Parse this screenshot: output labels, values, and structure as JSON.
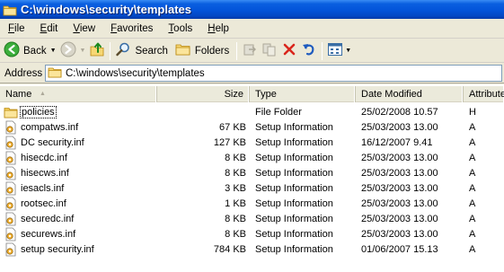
{
  "window": {
    "title": "C:\\windows\\security\\templates"
  },
  "menu": [
    "File",
    "Edit",
    "View",
    "Favorites",
    "Tools",
    "Help"
  ],
  "toolbar": {
    "back_label": "Back",
    "search_label": "Search",
    "folders_label": "Folders"
  },
  "address": {
    "label": "Address",
    "value": "C:\\windows\\security\\templates"
  },
  "columns": {
    "name": "Name",
    "size": "Size",
    "type": "Type",
    "date": "Date Modified",
    "attr": "Attributes"
  },
  "files": [
    {
      "name": "policies",
      "size": "",
      "type": "File Folder",
      "date": "25/02/2008 10.57",
      "attr": "H",
      "icon": "folder-icon"
    },
    {
      "name": "compatws.inf",
      "size": "67 KB",
      "type": "Setup Information",
      "date": "25/03/2003 13.00",
      "attr": "A",
      "icon": "setup-inf-icon"
    },
    {
      "name": "DC security.inf",
      "size": "127 KB",
      "type": "Setup Information",
      "date": "16/12/2007 9.41",
      "attr": "A",
      "icon": "setup-inf-icon"
    },
    {
      "name": "hisecdc.inf",
      "size": "8 KB",
      "type": "Setup Information",
      "date": "25/03/2003 13.00",
      "attr": "A",
      "icon": "setup-inf-icon"
    },
    {
      "name": "hisecws.inf",
      "size": "8 KB",
      "type": "Setup Information",
      "date": "25/03/2003 13.00",
      "attr": "A",
      "icon": "setup-inf-icon"
    },
    {
      "name": "iesacls.inf",
      "size": "3 KB",
      "type": "Setup Information",
      "date": "25/03/2003 13.00",
      "attr": "A",
      "icon": "setup-inf-icon"
    },
    {
      "name": "rootsec.inf",
      "size": "1 KB",
      "type": "Setup Information",
      "date": "25/03/2003 13.00",
      "attr": "A",
      "icon": "setup-inf-icon"
    },
    {
      "name": "securedc.inf",
      "size": "8 KB",
      "type": "Setup Information",
      "date": "25/03/2003 13.00",
      "attr": "A",
      "icon": "setup-inf-icon"
    },
    {
      "name": "securews.inf",
      "size": "8 KB",
      "type": "Setup Information",
      "date": "25/03/2003 13.00",
      "attr": "A",
      "icon": "setup-inf-icon"
    },
    {
      "name": "setup security.inf",
      "size": "784 KB",
      "type": "Setup Information",
      "date": "01/06/2007 15.13",
      "attr": "A",
      "icon": "setup-inf-icon"
    }
  ]
}
